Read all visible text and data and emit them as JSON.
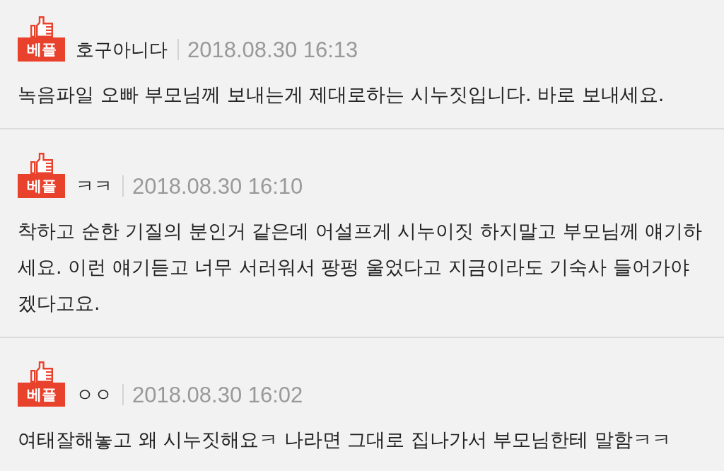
{
  "comments": [
    {
      "badge": "베플",
      "author": "호구아니다",
      "date": "2018.08.30 16:13",
      "text": "녹음파일 오빠 부모님께 보내는게 제대로하는 시누짓입니다. 바로 보내세요."
    },
    {
      "badge": "베플",
      "author": "ㅋㅋ",
      "date": "2018.08.30 16:10",
      "text": "착하고 순한 기질의 분인거 같은데 어설프게 시누이짓 하지말고 부모님께 얘기하세요. 이런 얘기듣고 너무 서러워서 팡펑 울었다고 지금이라도 기숙사 들어가야겠다고요."
    },
    {
      "badge": "베플",
      "author": "ㅇㅇ",
      "date": "2018.08.30 16:02",
      "text": "여태잘해놓고 왜 시누짓해요ㅋ 나라면 그대로 집나가서 부모님한테 말함ㅋㅋ"
    }
  ]
}
